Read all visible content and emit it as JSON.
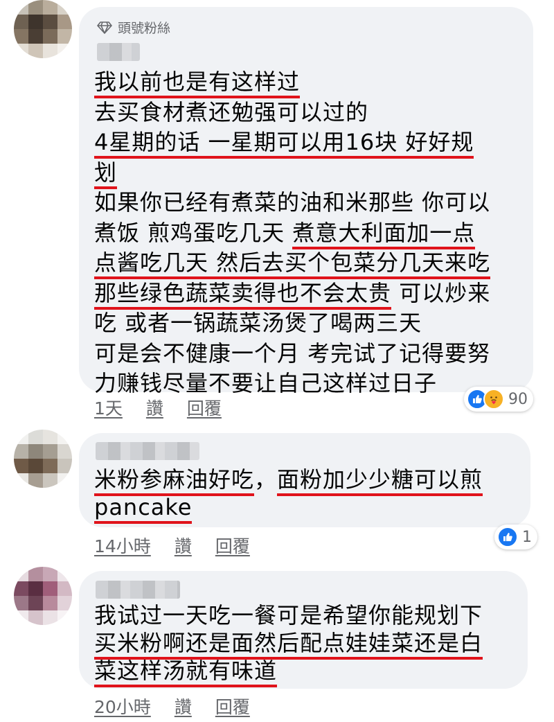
{
  "comments": [
    {
      "badge": "頭號粉絲",
      "lines": [
        [
          {
            "t": "我以前也是有这样过",
            "u": true
          }
        ],
        [
          {
            "t": "去买食材煮还勉强可以过的",
            "u": false
          }
        ],
        [
          {
            "t": "4星期的话 一星期可以用16块 好好规",
            "u": true
          }
        ],
        [
          {
            "t": "划",
            "u": true
          }
        ],
        [
          {
            "t": "如果你已经有煮菜的油和米那些 你可以",
            "u": false
          }
        ],
        [
          {
            "t": "煮饭 煎鸡蛋吃几天 ",
            "u": false
          },
          {
            "t": "煮意大利面加一点",
            "u": true
          }
        ],
        [
          {
            "t": "点酱吃几天 然后去买个包菜分几天来吃",
            "u": true
          }
        ],
        [
          {
            "t": "那些绿色蔬菜卖得也不会太贵",
            "u": true
          },
          {
            "t": " 可以炒来",
            "u": false
          }
        ],
        [
          {
            "t": "吃 或者一锅蔬菜汤煲了喝两三天",
            "u": false
          }
        ],
        [
          {
            "t": "可是会不健康一个月 考完试了记得要努",
            "u": false
          }
        ],
        [
          {
            "t": "力赚钱尽量不要让自己这样过日子",
            "u": false
          }
        ]
      ],
      "time": "1天",
      "like": "讚",
      "reply": "回覆",
      "reaction_count": "90"
    },
    {
      "lines": [
        [
          {
            "t": "米粉参麻油好吃",
            "u": true
          },
          {
            "t": "，",
            "u": false
          },
          {
            "t": "面粉加少少糖可以煎",
            "u": true
          }
        ],
        [
          {
            "t": "pancake",
            "u": true
          }
        ]
      ],
      "time": "14小時",
      "like": "讚",
      "reply": "回覆",
      "reaction_count": "1"
    },
    {
      "lines": [
        [
          {
            "t": "我试过一天吃一餐可是希望你能规划下",
            "u": false
          }
        ],
        [
          {
            "t": "买米粉啊还是面然后配点娃娃菜还是白",
            "u": true
          }
        ],
        [
          {
            "t": "菜这样汤就有味道",
            "u": true
          }
        ]
      ],
      "time": "20小時",
      "like": "讚",
      "reply": "回覆"
    }
  ],
  "colors": {
    "underline": "#e0131b",
    "bubble": "#f0f2f5",
    "meta": "#65676b",
    "like": "#1877f2"
  }
}
